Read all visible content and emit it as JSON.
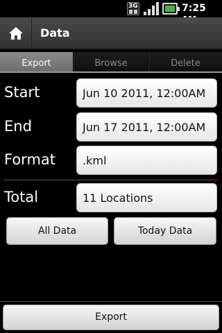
{
  "status_bar": {
    "network": "3G",
    "time": "7:25",
    "time_suffix": "AM"
  },
  "title_bar": {
    "title": "Data"
  },
  "tabs": [
    {
      "label": "Export",
      "active": true
    },
    {
      "label": "Browse",
      "active": false
    },
    {
      "label": "Delete",
      "active": false
    }
  ],
  "form": {
    "start_label": "Start",
    "start_value": "Jun 10 2011, 12:00AM",
    "end_label": "End",
    "end_value": "Jun 17 2011, 12:00AM",
    "format_label": "Format",
    "format_value": ".kml",
    "total_label": "Total",
    "total_value": "11 Locations"
  },
  "buttons": {
    "all_data": "All Data",
    "today_data": "Today Data",
    "export": "Export"
  },
  "colors": {
    "battery": "#4caf50",
    "divider": "#9a3b2c"
  }
}
